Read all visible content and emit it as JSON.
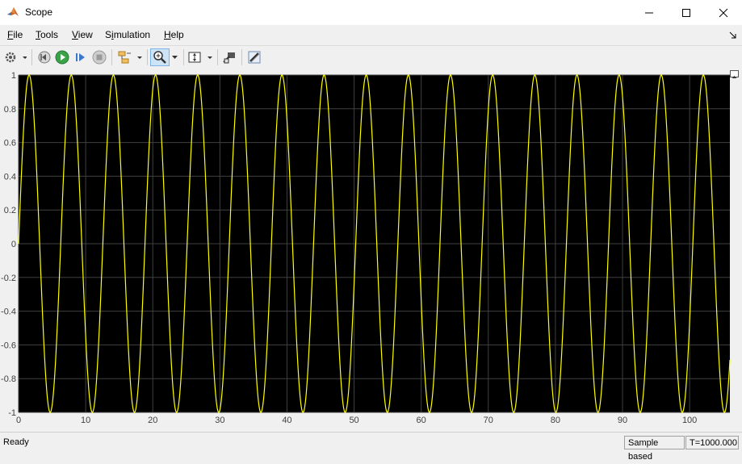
{
  "window": {
    "title": "Scope"
  },
  "menu": [
    {
      "acc": "F",
      "rest": "ile"
    },
    {
      "acc": "T",
      "rest": "ools"
    },
    {
      "acc": "V",
      "rest": "iew"
    },
    {
      "pre": "S",
      "acc": "i",
      "rest": "mulation"
    },
    {
      "acc": "H",
      "rest": "elp"
    }
  ],
  "status": {
    "ready": "Ready",
    "mode": "Sample based",
    "time": "T=1000.000"
  },
  "colors": {
    "plot_bg": "#000000",
    "signal": "#ffff00",
    "grid": "#404040",
    "axes_text": "#404040"
  },
  "chart_data": {
    "type": "line",
    "title": "",
    "xlabel": "",
    "ylabel": "",
    "xlim": [
      0,
      106
    ],
    "ylim": [
      -1,
      1
    ],
    "xticks": [
      0,
      10,
      20,
      30,
      40,
      50,
      60,
      70,
      80,
      90,
      100
    ],
    "yticks": [
      -1,
      -0.8,
      -0.6,
      -0.4,
      -0.2,
      0,
      0.2,
      0.4,
      0.6,
      0.8,
      1
    ],
    "ytick_labels": [
      "-1",
      "-0.8",
      "-0.6",
      "-0.4",
      "-0.2",
      "0",
      "0.2",
      "0.4",
      "0.6",
      "0.8",
      "1"
    ],
    "grid": true,
    "series": [
      {
        "function": "sin",
        "amplitude": 1,
        "period": 6.28,
        "x_start": 0,
        "x_end": 106
      }
    ]
  }
}
